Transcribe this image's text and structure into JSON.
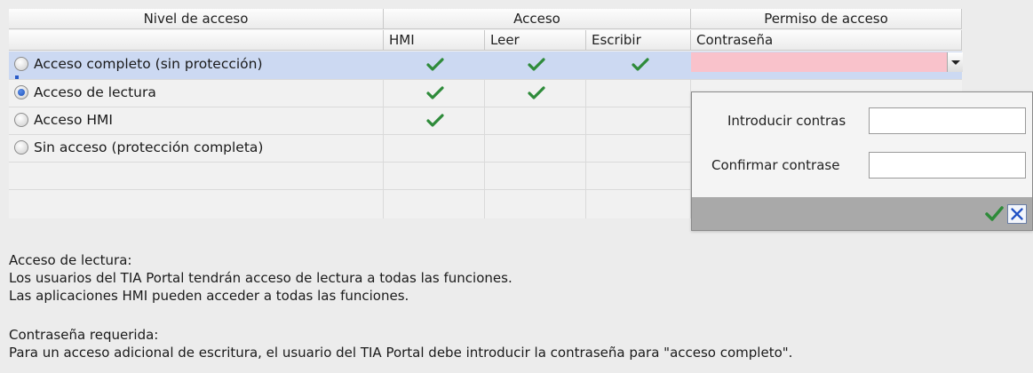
{
  "columns": {
    "group1": "Nivel de acceso",
    "group2": "Acceso",
    "group3": "Permiso de acceso",
    "hmi": "HMI",
    "leer": "Leer",
    "escribir": "Escribir",
    "contrasena": "Contraseña"
  },
  "rows": [
    {
      "label": "Acceso completo (sin protección)",
      "selected": false,
      "highlighted": true,
      "hmi": true,
      "leer": true,
      "escribir": true
    },
    {
      "label": "Acceso de lectura",
      "selected": true,
      "highlighted": false,
      "hmi": true,
      "leer": true,
      "escribir": false
    },
    {
      "label": "Acceso HMI",
      "selected": false,
      "highlighted": false,
      "hmi": true,
      "leer": false,
      "escribir": false
    },
    {
      "label": "Sin acceso (protección completa)",
      "selected": false,
      "highlighted": false,
      "hmi": false,
      "leer": false,
      "escribir": false
    }
  ],
  "popup": {
    "enter_label": "Introducir contras",
    "confirm_label": "Confirmar contrase",
    "enter_value": "",
    "confirm_value": ""
  },
  "description": {
    "title1": "Acceso de lectura:",
    "line1": "Los usuarios del TIA Portal tendrán acceso de lectura a todas las funciones.",
    "line2": "Las aplicaciones HMI pueden acceder a todas las funciones.",
    "title2": "Contraseña requerida:",
    "line3": "Para un acceso adicional de escritura, el usuario del TIA Portal debe introducir la contraseña para \"acceso completo\"."
  },
  "colors": {
    "check": "#2e8b3a",
    "selected_row": "#ccd9f2",
    "password_cell": "#f9c2cb",
    "cancel": "#1f4fc4"
  },
  "icons": {
    "check": "checkmark-icon",
    "confirm": "checkmark-icon",
    "cancel": "x-icon"
  }
}
